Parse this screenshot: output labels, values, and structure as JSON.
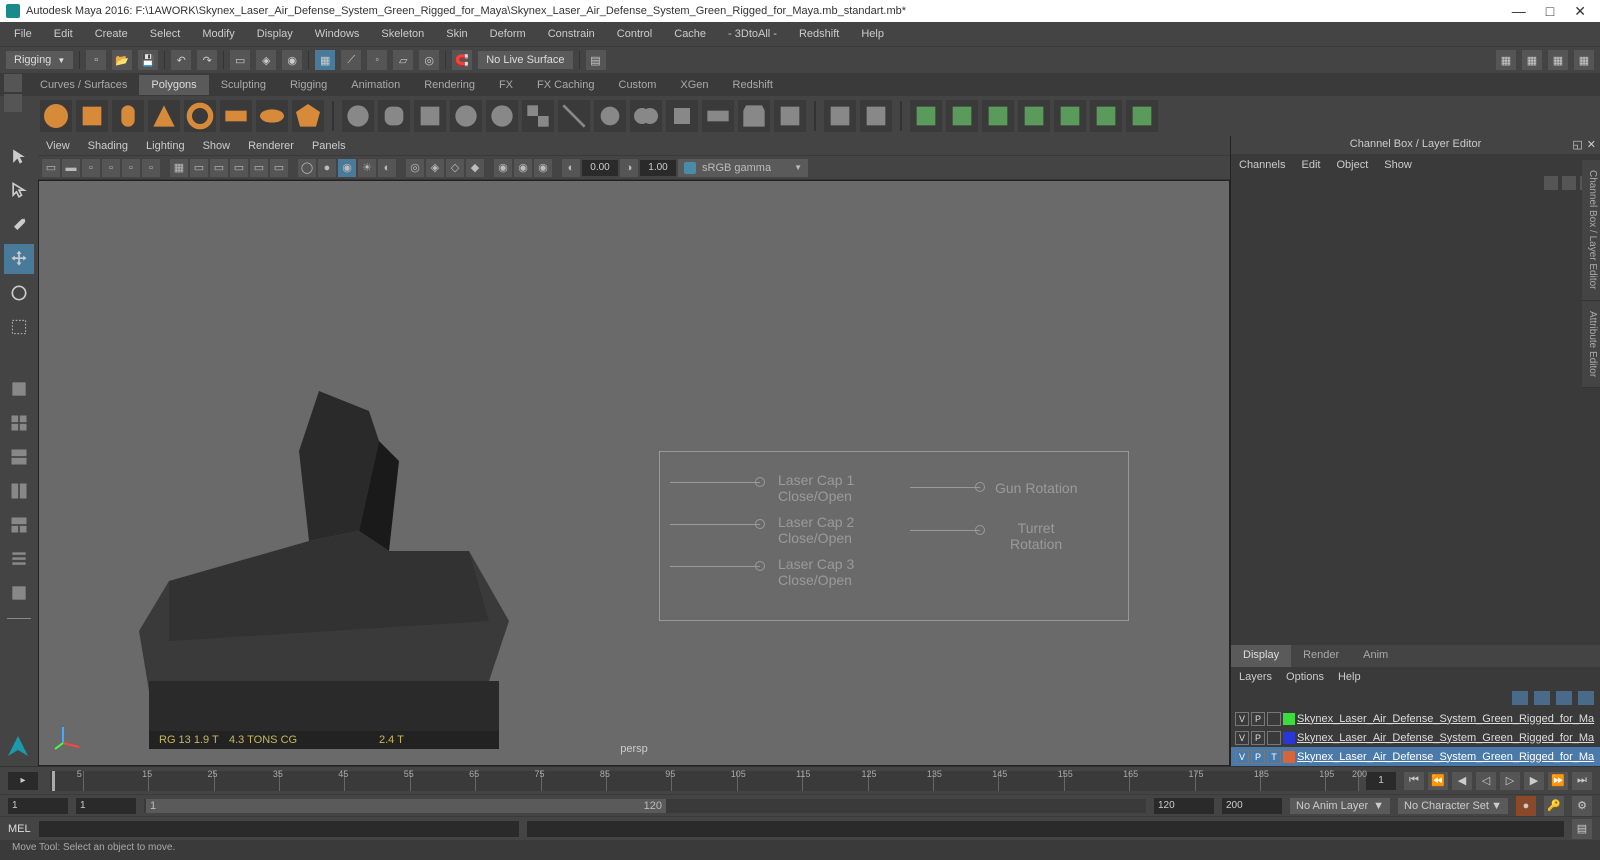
{
  "title": "Autodesk Maya 2016: F:\\1AWORK\\Skynex_Laser_Air_Defense_System_Green_Rigged_for_Maya\\Skynex_Laser_Air_Defense_System_Green_Rigged_for_Maya.mb_standart.mb*",
  "menubar": [
    "File",
    "Edit",
    "Create",
    "Select",
    "Modify",
    "Display",
    "Windows",
    "Skeleton",
    "Skin",
    "Deform",
    "Constrain",
    "Control",
    "Cache",
    "- 3DtoAll -",
    "Redshift",
    "Help"
  ],
  "mode_dropdown": "Rigging",
  "no_live": "No Live Surface",
  "shelf_tabs": [
    "Curves / Surfaces",
    "Polygons",
    "Sculpting",
    "Rigging",
    "Animation",
    "Rendering",
    "FX",
    "FX Caching",
    "Custom",
    "XGen",
    "Redshift"
  ],
  "shelf_active": 1,
  "viewport_menus": [
    "View",
    "Shading",
    "Lighting",
    "Show",
    "Renderer",
    "Panels"
  ],
  "vp_num1": "0.00",
  "vp_num2": "1.00",
  "vp_colorspace": "sRGB gamma",
  "persp_label": "persp",
  "rig": {
    "c1": "Laser Cap 1\nClose/Open",
    "c2": "Laser Cap 2\nClose/Open",
    "c3": "Laser Cap 3\nClose/Open",
    "gun": "Gun Rotation",
    "turret": "Turret\nRotation"
  },
  "channelbox": {
    "title": "Channel Box / Layer Editor",
    "menus": [
      "Channels",
      "Edit",
      "Object",
      "Show"
    ]
  },
  "layer_tabs": [
    "Display",
    "Render",
    "Anim"
  ],
  "layer_active": 0,
  "layer_menus": [
    "Layers",
    "Options",
    "Help"
  ],
  "layers": [
    {
      "v": "V",
      "p": "P",
      "t": "",
      "color": "#3bdc3b",
      "name": "Skynex_Laser_Air_Defense_System_Green_Rigged_for_Ma",
      "sel": false
    },
    {
      "v": "V",
      "p": "P",
      "t": "",
      "color": "#2838d8",
      "name": "Skynex_Laser_Air_Defense_System_Green_Rigged_for_Ma",
      "sel": false
    },
    {
      "v": "V",
      "p": "P",
      "t": "T",
      "color": "#d8643a",
      "name": "Skynex_Laser_Air_Defense_System_Green_Rigged_for_Ma",
      "sel": true
    }
  ],
  "rightvtabs": [
    "Channel Box / Layer Editor",
    "Attribute Editor"
  ],
  "timeline": {
    "ticks": [
      5,
      15,
      25,
      35,
      45,
      55,
      65,
      75,
      85,
      95,
      105,
      115,
      125,
      135,
      145,
      155,
      165,
      175,
      185,
      195,
      200
    ],
    "current": "1"
  },
  "range": {
    "start": "1",
    "inner_start": "1",
    "inner_end": "120",
    "end": "120",
    "outer_end": "200"
  },
  "anim_layer": "No Anim Layer",
  "char_set": "No Character Set",
  "cmd": {
    "label": "MEL"
  },
  "help": "Move Tool: Select an object to move."
}
